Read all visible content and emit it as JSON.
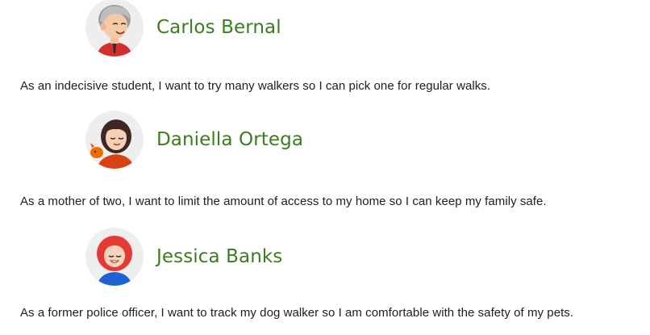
{
  "personas": [
    {
      "name": "Carlos Bernal",
      "avatar": "elderly-man-avatar",
      "story": "As an indecisive student, I want to try many walkers so I can pick one for regular walks."
    },
    {
      "name": "Daniella Ortega",
      "avatar": "woman-with-dog-avatar",
      "story": "As a mother of two, I want to limit the amount of access to my home so I can keep my family safe."
    },
    {
      "name": "Jessica Banks",
      "avatar": "red-haired-woman-avatar",
      "story": "As a former police officer, I want to track my dog walker so I am comfortable with the safety of my pets."
    }
  ],
  "colors": {
    "name_green": "#3a7d1f",
    "body_text": "#202020",
    "avatar_bg": "#eeeeee"
  }
}
